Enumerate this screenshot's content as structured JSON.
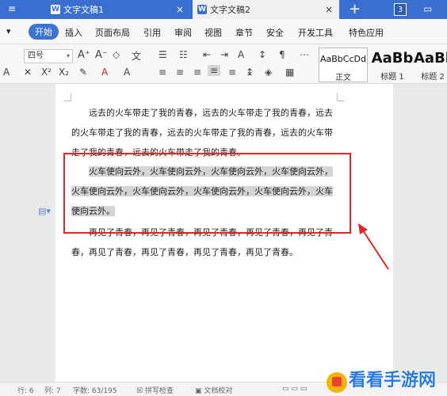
{
  "tabs": [
    {
      "label": "文字文稿1"
    },
    {
      "label": "文字文稿2"
    }
  ],
  "tab_count": "3",
  "menu": {
    "start": "开始",
    "items": [
      "插入",
      "页面布局",
      "引用",
      "审阅",
      "视图",
      "章节",
      "安全",
      "开发工具",
      "特色应用"
    ]
  },
  "toolbar": {
    "font_size": "四号",
    "styles": [
      {
        "sample": "AaBbCcDd",
        "name": "正文"
      },
      {
        "sample": "AaBb",
        "name": "标题 1"
      },
      {
        "sample": "AaBb",
        "name": "标题 2"
      }
    ]
  },
  "document": {
    "para1": "远去的火车带走了我的青春，远去的火车带走了我的青春，远去的火车带走了我的青春，远去的火车带走了我的青春，远去的火车带走了我的青春，远去的火车带走了我的青春。",
    "para2": "火车使向云外，火车使向云外，火车使向云外，火车使向云外，火车使向云外，火车使向云外，火车使向云外，火车使向云外，火车使向云外。",
    "para3": "再见了青春，再见了青春，再见了青春，再见了青春，再见了青春，再见了青春，再见了青春，再见了青春，再见了青春。"
  },
  "status": {
    "row": "行: 6",
    "col": "列: 7",
    "words": "字数: 63/195",
    "spell": "拼写检查",
    "proof": "文档校对"
  },
  "watermark": "看看手游网",
  "colors": {
    "accent": "#3b74d6",
    "highlight_box": "#e0262a"
  }
}
